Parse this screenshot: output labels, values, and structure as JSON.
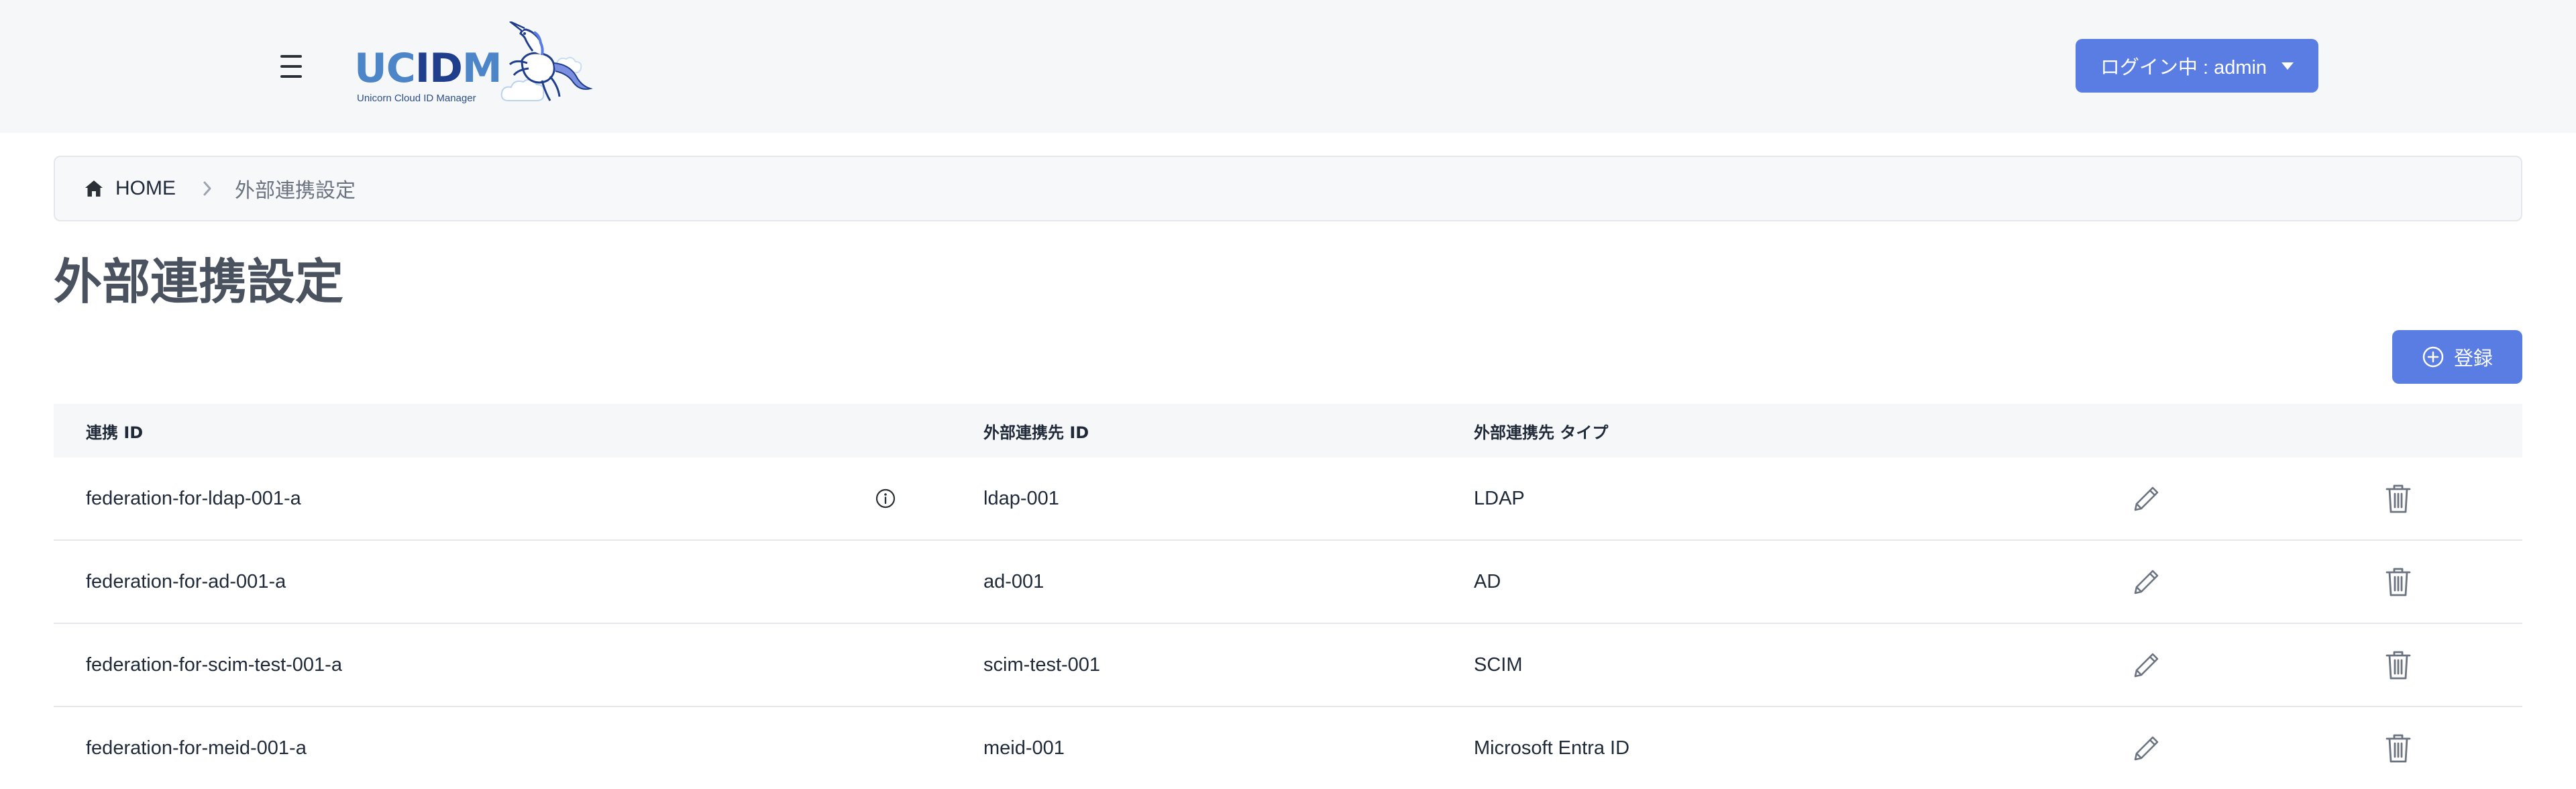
{
  "header": {
    "logo": {
      "text_uc": "UC",
      "text_id": "ID",
      "text_m": "M",
      "subtitle": "Unicorn Cloud ID Manager"
    },
    "login_label": "ログイン中 : admin",
    "menu_icon": "hamburger-icon",
    "dropdown_icon": "caret-down-icon"
  },
  "breadcrumb": {
    "home_label": "HOME",
    "current_label": "外部連携設定",
    "home_icon": "home-icon",
    "separator_icon": "chevron-right-icon"
  },
  "page": {
    "title": "外部連携設定",
    "register_label": "登録",
    "register_icon": "plus-circle-icon"
  },
  "table": {
    "headers": {
      "federation_id": "連携 ID",
      "external_id": "外部連携先 ID",
      "external_type": "外部連携先 タイプ"
    },
    "rows": [
      {
        "federation_id": "federation-for-ldap-001-a",
        "external_id": "ldap-001",
        "external_type": "LDAP",
        "has_info": true
      },
      {
        "federation_id": "federation-for-ad-001-a",
        "external_id": "ad-001",
        "external_type": "AD",
        "has_info": false
      },
      {
        "federation_id": "federation-for-scim-test-001-a",
        "external_id": "scim-test-001",
        "external_type": "SCIM",
        "has_info": false
      },
      {
        "federation_id": "federation-for-meid-001-a",
        "external_id": "meid-001",
        "external_type": "Microsoft Entra ID",
        "has_info": false
      }
    ],
    "row_icons": {
      "info": "info-circle-icon",
      "edit": "pencil-icon",
      "delete": "trash-icon"
    }
  },
  "colors": {
    "primary": "#5a7de3",
    "header_bg": "#f6f7f9",
    "title_text": "#4a5260",
    "logo_light": "#4d86c8",
    "logo_dark": "#1f3f8c"
  }
}
